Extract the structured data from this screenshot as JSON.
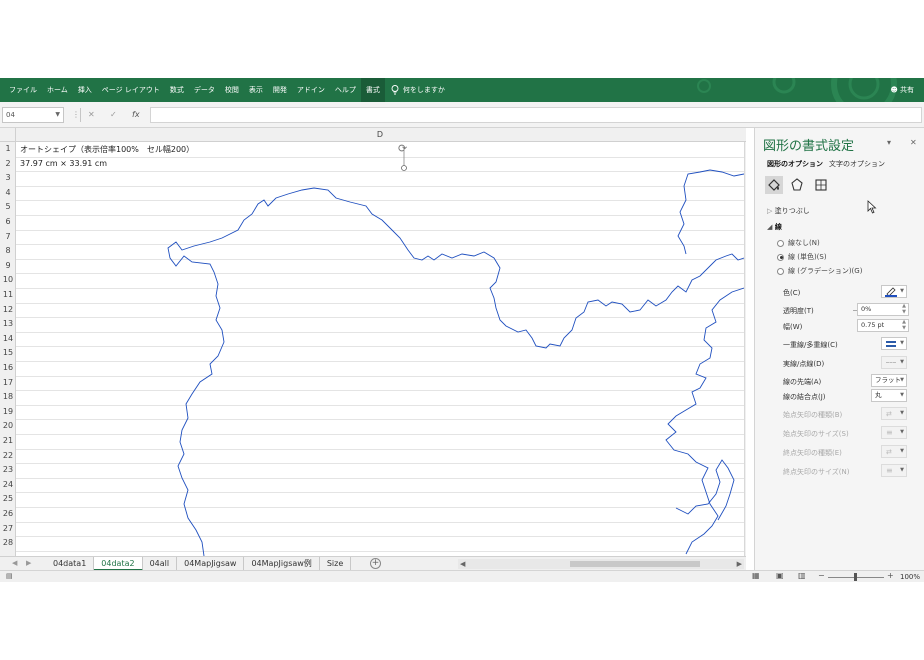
{
  "ribbon": {
    "tabs": [
      "ファイル",
      "ホーム",
      "挿入",
      "ページ レイアウト",
      "数式",
      "データ",
      "校閲",
      "表示",
      "開発",
      "アドイン",
      "ヘルプ",
      "書式"
    ],
    "active_tab": "書式",
    "tell_me": "何をしますか",
    "share": "共有",
    "accent_color": "#217346"
  },
  "formula_bar": {
    "name_box": "04",
    "fx_label": "fx",
    "formula": ""
  },
  "sheet": {
    "column_header": "D",
    "rows": [
      "1",
      "2",
      "3",
      "4",
      "5",
      "6",
      "7",
      "8",
      "9",
      "10",
      "11",
      "12",
      "13",
      "14",
      "15",
      "16",
      "17",
      "18",
      "19",
      "20",
      "21",
      "22",
      "23",
      "24",
      "25",
      "26",
      "27",
      "28"
    ],
    "cell_a1": "オートシェイプ（表示倍率100%　セル幅200）",
    "cell_a2": "37.97 cm × 33.91 cm"
  },
  "sheet_tabs": {
    "tabs": [
      "04data1",
      "04data2",
      "04all",
      "04MapJigsaw",
      "04MapJigsaw例",
      "Size"
    ],
    "active": "04data2"
  },
  "status": {
    "zoom": "100%"
  },
  "pane": {
    "title": "図形の書式設定",
    "tab_shape": "図形のオプション",
    "tab_text": "文字のオプション",
    "icons": [
      "fill-line-icon",
      "effects-icon",
      "size-properties-icon"
    ],
    "section_fill": "塗りつぶし",
    "section_line": "線",
    "radios": [
      {
        "label": "線なし(N)",
        "checked": false
      },
      {
        "label": "線 (単色)(S)",
        "checked": true
      },
      {
        "label": "線 (グラデーション)(G)",
        "checked": false
      }
    ],
    "props": {
      "color": "色(C)",
      "transparency": "透明度(T)",
      "transparency_value": "0%",
      "width": "幅(W)",
      "width_value": "0.75 pt",
      "compound": "一重線/多重線(C)",
      "dash": "実線/点線(D)",
      "cap": "線の先端(A)",
      "cap_value": "フラット",
      "join": "線の結合点(J)",
      "join_value": "丸",
      "begin_arrow_type": "始点矢印の種類(B)",
      "begin_arrow_size": "始点矢印のサイズ(S)",
      "end_arrow_type": "終点矢印の種類(E)",
      "end_arrow_size": "終点矢印のサイズ(N)"
    },
    "line_color": "#1f4fbf"
  }
}
